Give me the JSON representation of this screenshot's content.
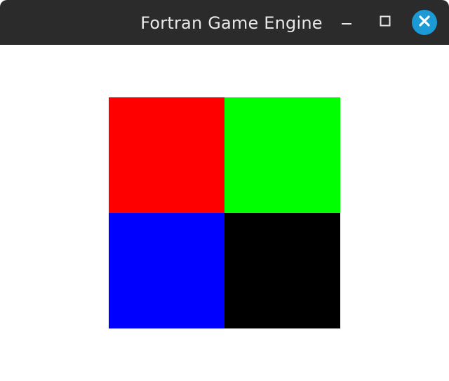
{
  "window": {
    "title": "Fortran Game Engine",
    "controls": {
      "minimize_icon": "minimize-icon",
      "maximize_icon": "maximize-icon",
      "close_icon": "close-icon",
      "close_color": "#1b9ad6"
    }
  },
  "scene": {
    "background": "#ffffff",
    "quadrants": [
      {
        "position": "top-left",
        "color": "#ff0000"
      },
      {
        "position": "top-right",
        "color": "#00ff00"
      },
      {
        "position": "bottom-left",
        "color": "#0000ff"
      },
      {
        "position": "bottom-right",
        "color": "#000000"
      }
    ]
  }
}
